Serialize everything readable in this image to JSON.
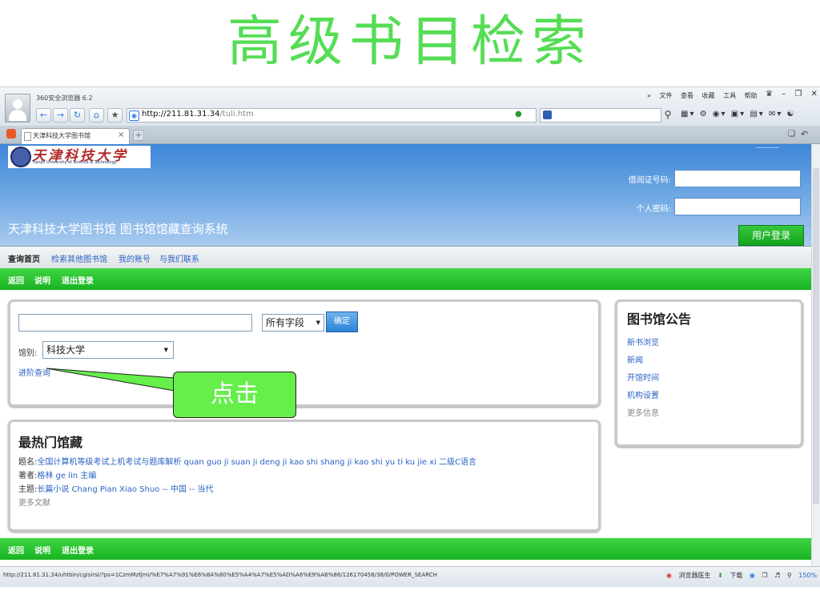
{
  "slide": {
    "title": "高级书目检索"
  },
  "browser": {
    "name": "360安全浏览器 6.2",
    "menu": [
      "文件",
      "查看",
      "收藏",
      "工具",
      "帮助"
    ],
    "address": {
      "host": "http://211.81.31.34",
      "path": "/tuli.htm"
    },
    "tab_title": "天津科技大学图书馆",
    "status_url": "http://211.81.31.34/uhtbin/cgisirsi/?ps=1CzmMzfjmi/%E7%A7%91%E6%8A%80%E5%A4%A7%E5%AD%A6%E9%A6%86/126170458/38/0/POWER_SEARCH",
    "status_items": [
      "浏览器医生",
      "下载"
    ],
    "zoom": "150%"
  },
  "site": {
    "logo_cn": "天津科技大学",
    "logo_en": "Tianjin University of Science & Technology",
    "title": "天津科技大学图书馆  图书馆馆藏查询系统",
    "card_label": "借阅证号码:",
    "password_label": "个人密码:",
    "login": "用户登录",
    "nav_home": "查询首页",
    "nav_links": [
      "检索其他图书馆",
      "我的账号",
      "与我们联系"
    ],
    "green_links": [
      "返回",
      "说明",
      "退出登录"
    ]
  },
  "search": {
    "field_select": "所有字段",
    "ok": "确定",
    "library_label": "馆别:",
    "library_value": "科技大学",
    "advanced": "进阶查询"
  },
  "hot": {
    "title": "最热门馆藏",
    "rows": [
      {
        "label": "题名:",
        "value": "全国计算机等级考试上机考试与题库解析 quan guo ji suan ji deng ji kao shi shang ji kao shi yu ti ku jie xi 二级C语言"
      },
      {
        "label": "著者:",
        "value": "格林 ge lin 主编"
      },
      {
        "label": "主题:",
        "value": "长篇小说 Chang Pian Xiao Shuo -- 中国 -- 当代"
      }
    ],
    "more": "更多文献"
  },
  "notice": {
    "title": "图书馆公告",
    "items": [
      "新书浏览",
      "新闻",
      "开馆时间",
      "机构设置"
    ],
    "more": "更多信息"
  },
  "callout": {
    "text": "点击",
    "fill": "#66ee4a"
  },
  "colors": {
    "title_green": "#55dd55",
    "banner_blue": "#3d86d8",
    "bar_green": "#19b321",
    "link_blue": "#2a62c4"
  }
}
